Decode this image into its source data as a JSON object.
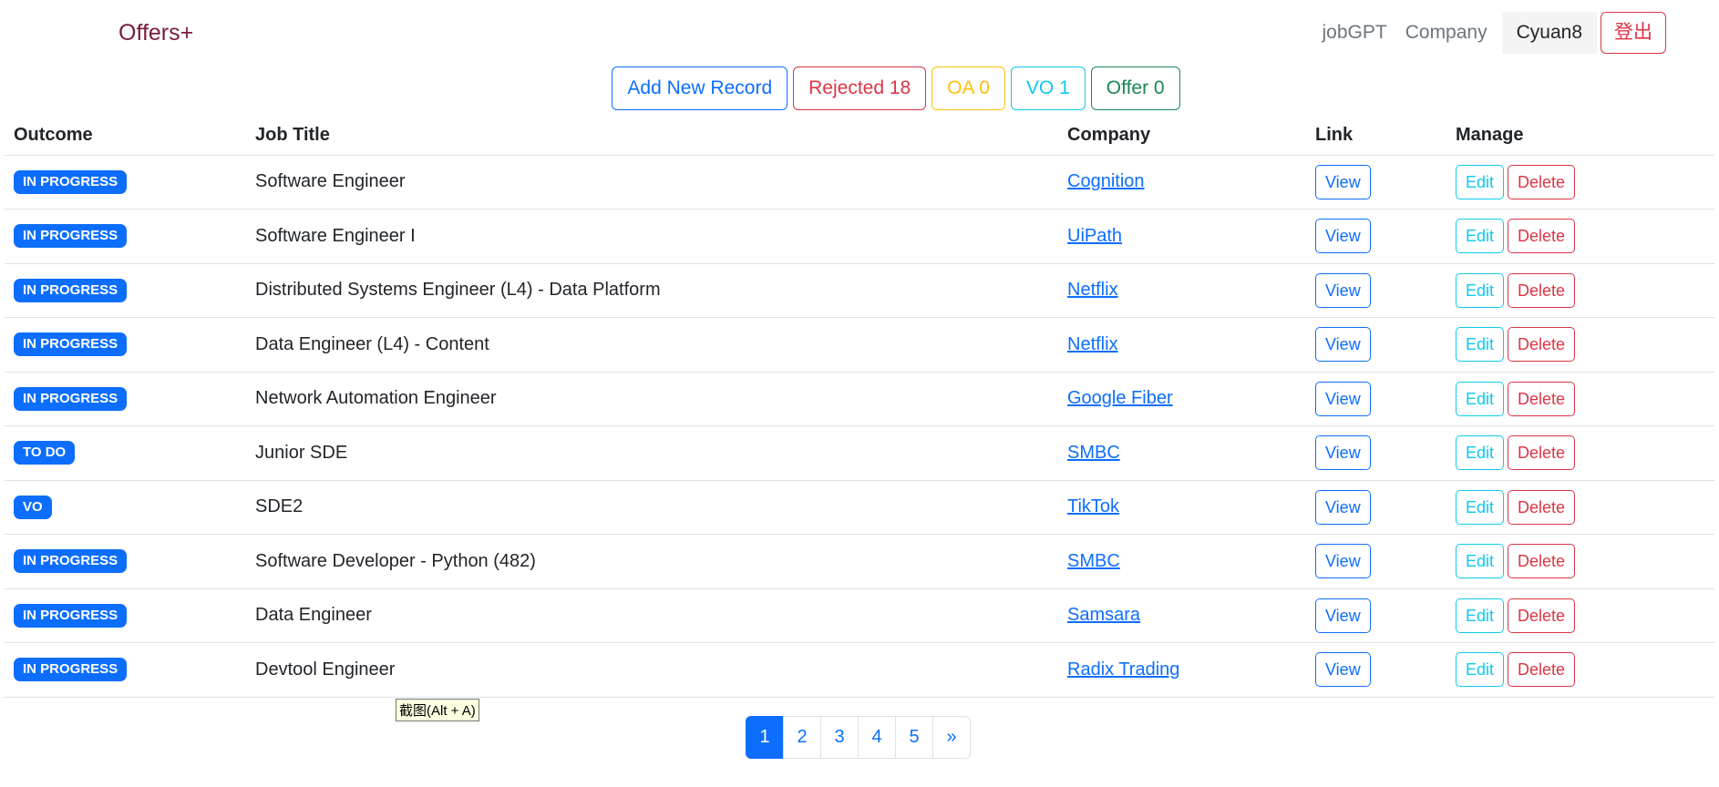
{
  "brand": "Offers+",
  "nav": {
    "jobgpt": "jobGPT",
    "company": "Company",
    "user": "Cyuan8",
    "logout": "登出"
  },
  "filters": {
    "add": "Add New Record",
    "rejected": "Rejected 18",
    "oa": "OA 0",
    "vo": "VO 1",
    "offer": "Offer 0"
  },
  "table": {
    "headers": [
      "Outcome",
      "Job Title",
      "Company",
      "Link",
      "Manage"
    ],
    "view_label": "View",
    "edit_label": "Edit",
    "delete_label": "Delete",
    "rows": [
      {
        "outcome": "IN PROGRESS",
        "title": "Software Engineer",
        "company": "Cognition"
      },
      {
        "outcome": "IN PROGRESS",
        "title": "Software Engineer I",
        "company": "UiPath"
      },
      {
        "outcome": "IN PROGRESS",
        "title": "Distributed Systems Engineer (L4) - Data Platform",
        "company": "Netflix"
      },
      {
        "outcome": "IN PROGRESS",
        "title": "Data Engineer (L4) - Content",
        "company": "Netflix"
      },
      {
        "outcome": "IN PROGRESS",
        "title": "Network Automation Engineer",
        "company": "Google Fiber"
      },
      {
        "outcome": "TO DO",
        "title": "Junior SDE",
        "company": "SMBC"
      },
      {
        "outcome": "VO",
        "title": "SDE2",
        "company": "TikTok"
      },
      {
        "outcome": "IN PROGRESS",
        "title": "Software Developer - Python (482)",
        "company": "SMBC"
      },
      {
        "outcome": "IN PROGRESS",
        "title": "Data Engineer",
        "company": "Samsara"
      },
      {
        "outcome": "IN PROGRESS",
        "title": "Devtool Engineer",
        "company": "Radix Trading"
      }
    ]
  },
  "tooltip": "截图(Alt + A)",
  "pagination": {
    "pages": [
      "1",
      "2",
      "3",
      "4",
      "5"
    ],
    "next": "»",
    "current": "1"
  },
  "colors": {
    "primary": "#0d6efd",
    "danger": "#dc3545",
    "warning": "#ffc107",
    "info": "#0dcaf0",
    "success": "#198754",
    "brand": "#7a1c3f"
  }
}
